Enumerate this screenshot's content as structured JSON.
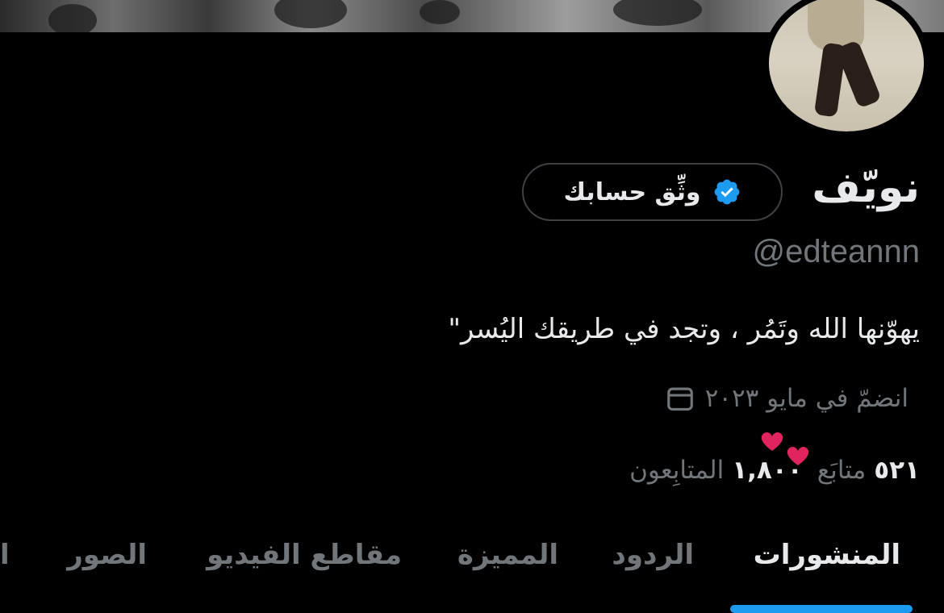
{
  "profile": {
    "display_name": "نويّف",
    "handle": "@edteannn",
    "bio": "يهوّنها الله وتَمُر ، وتجد في طريقك اليُسر\"",
    "joined": "انضمّ في مايو ٢٠٢٣",
    "following_count": "٥٢١",
    "following_label": "متابَع",
    "followers_count": "١,٨٠٠",
    "followers_label": "المتابِعون"
  },
  "verify_button": {
    "label": "وثِّق حسابك",
    "icon": "verified-badge-icon",
    "icon_color": "#1d9bf0"
  },
  "tabs": [
    {
      "label": "المنشورات",
      "active": true
    },
    {
      "label": "الردود",
      "active": false
    },
    {
      "label": "المميزة",
      "active": false
    },
    {
      "label": "مقاطع الفيديو",
      "active": false
    },
    {
      "label": "الصور",
      "active": false
    },
    {
      "label": "ا",
      "active": false
    }
  ],
  "colors": {
    "background": "#000000",
    "text_primary": "#e7e9ea",
    "text_secondary": "#71767b",
    "accent": "#1d9bf0",
    "hearts": "#e0245e"
  }
}
